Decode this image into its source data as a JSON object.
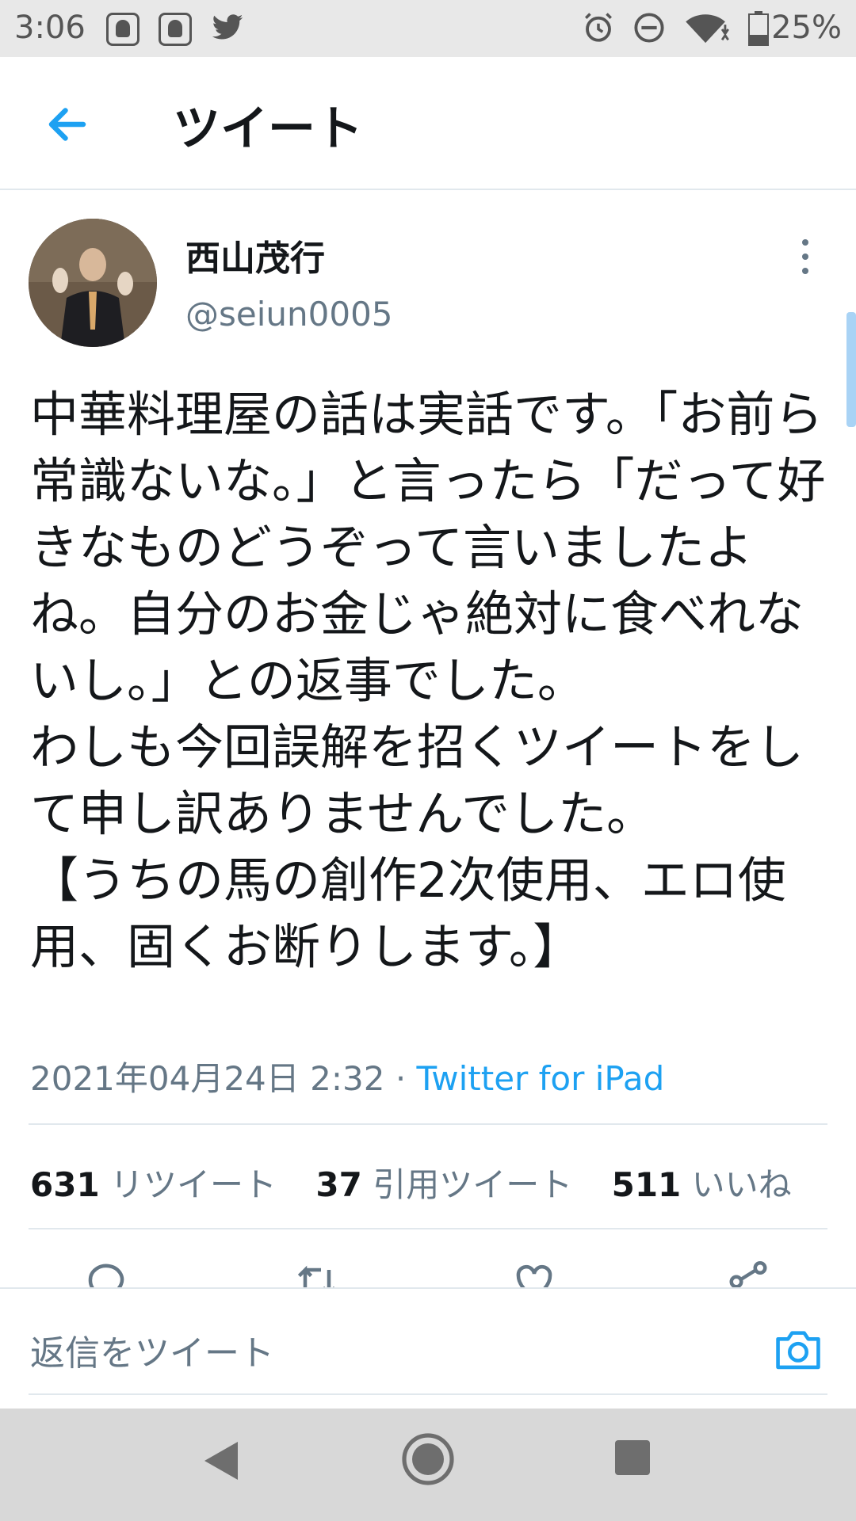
{
  "status_bar": {
    "time": "3:06",
    "battery": "25%",
    "icons": [
      "app-icon",
      "app-icon",
      "twitter-icon",
      "alarm-icon",
      "do-not-disturb-icon",
      "wifi-icon",
      "battery-icon"
    ]
  },
  "header": {
    "title": "ツイート"
  },
  "tweet": {
    "author_name": "西山茂行",
    "author_handle": "@seiun0005",
    "text": "中華料理屋の話は実話です。「お前ら常識ないな。」と言ったら「だって好きなものどうぞって言いましたよね。自分のお金じゃ絶対に食べれないし。」との返事でした。\nわしも今回誤解を招くツイートをして申し訳ありませんでした。\n【うちの馬の創作2次使用、エロ使用、固くお断りします。】",
    "timestamp": "2021年04月24日 2:32",
    "separator": "·",
    "source": "Twitter for iPad"
  },
  "stats": {
    "retweets_count": "631",
    "retweets_label": "リツイート",
    "quotes_count": "37",
    "quotes_label": "引用ツイート",
    "likes_count": "511",
    "likes_label": "いいね"
  },
  "reply": {
    "placeholder": "返信をツイート"
  },
  "colors": {
    "accent": "#1da1f2",
    "text": "#14171a",
    "secondary": "#657786",
    "divider": "#e1e8ed"
  }
}
